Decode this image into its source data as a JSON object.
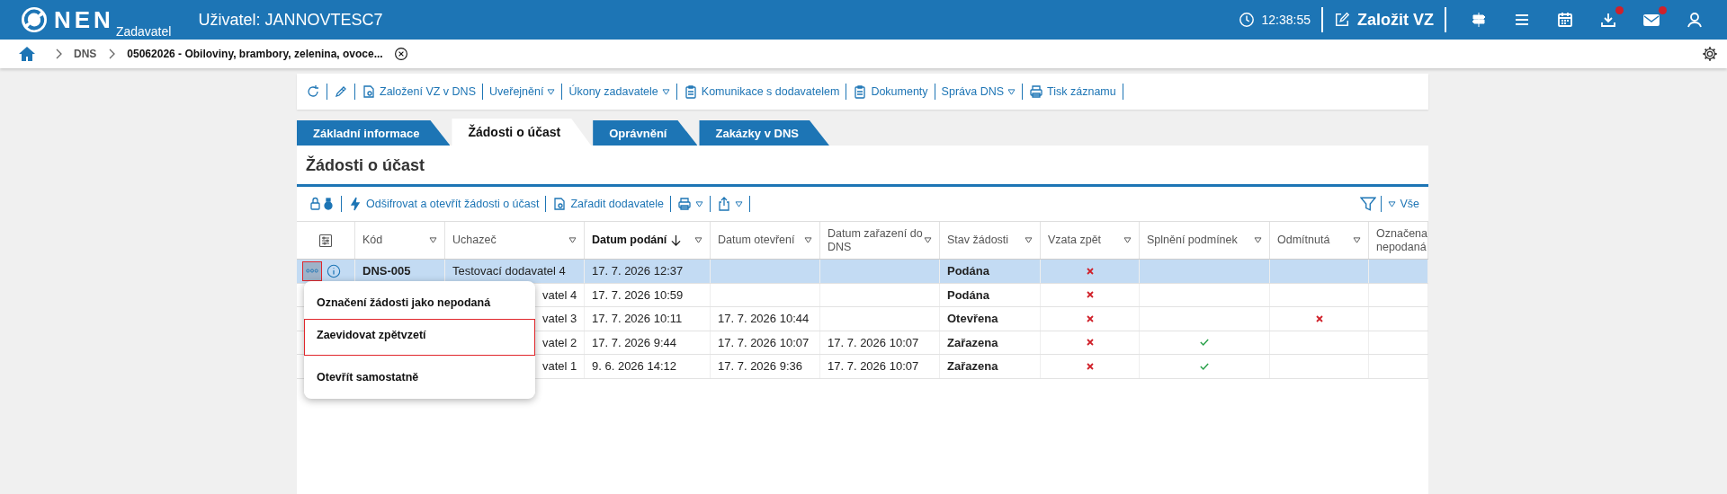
{
  "header": {
    "logo": "NEN",
    "role": "Zadavatel",
    "user": "Uživatel: JANNOVTESC7",
    "time": "12:38:55",
    "create_button": "Založit VZ",
    "icons": [
      {
        "kind": "signpost",
        "badge": false
      },
      {
        "kind": "menu",
        "badge": false
      },
      {
        "kind": "calendar",
        "badge": false
      },
      {
        "kind": "download",
        "badge": true
      },
      {
        "kind": "mail",
        "badge": true
      },
      {
        "kind": "user",
        "badge": false
      }
    ]
  },
  "breadcrumb": [
    "DNS",
    "05062026 - Obiloviny, brambory, zelenina, ovoce..."
  ],
  "toolbar": [
    {
      "kind": "refresh",
      "dropdown": false
    },
    {
      "kind": "pencil",
      "dropdown": false
    },
    {
      "kind": "gear-doc",
      "label": "Založení VZ v DNS",
      "dropdown": false
    },
    {
      "kind": "text",
      "label": "Uveřejnění",
      "dropdown": true
    },
    {
      "kind": "text",
      "label": "Úkony zadavatele",
      "dropdown": true
    },
    {
      "kind": "clipboard",
      "label": "Komunikace s dodavatelem",
      "dropdown": false
    },
    {
      "kind": "clipboard",
      "label": "Dokumenty",
      "dropdown": false
    },
    {
      "kind": "text",
      "label": "Správa DNS",
      "dropdown": true
    },
    {
      "kind": "printer",
      "label": "Tisk záznamu",
      "dropdown": false
    }
  ],
  "tabs": [
    {
      "label": "Základní informace",
      "selected": false
    },
    {
      "label": "Žádosti o účast",
      "selected": true
    },
    {
      "label": "Oprávnění",
      "selected": false
    },
    {
      "label": "Zakázky v DNS",
      "selected": false
    }
  ],
  "section": {
    "title": "Žádosti o účast",
    "actions": [
      {
        "kind": "lock",
        "dropdown": false
      },
      {
        "kind": "bolt",
        "label": "Odšifrovat a otevřít žádosti o účast",
        "dropdown": false
      },
      {
        "kind": "gear-doc",
        "label": "Zařadit dodavatele",
        "dropdown": false
      },
      {
        "kind": "printer",
        "dropdown": true
      },
      {
        "kind": "share",
        "dropdown": true
      }
    ],
    "filter_label": "Vše"
  },
  "table": {
    "columns": [
      {
        "label": "Kód",
        "sorted": false
      },
      {
        "label": "Uchazeč",
        "sorted": false
      },
      {
        "label": "Datum podání",
        "sorted": true
      },
      {
        "label": "Datum otevření",
        "sorted": false
      },
      {
        "label": "Datum zařazení do DNS",
        "sorted": false
      },
      {
        "label": "Stav žádosti",
        "sorted": false
      },
      {
        "label": "Vzata zpět",
        "sorted": false
      },
      {
        "label": "Splnění podmínek",
        "sorted": false
      },
      {
        "label": "Odmítnutá",
        "sorted": false
      },
      {
        "label": "Označena nepodaná",
        "sorted": false
      }
    ],
    "rows": [
      {
        "selected": true,
        "menu_open": true,
        "code": "DNS-005",
        "applicant": "Testovací dodavatel 4",
        "submitted": "17. 7. 2026 12:37",
        "status": "Podána",
        "withdrawn": {
          "kind": "cross"
        }
      },
      {
        "selected": false,
        "menu_open": false,
        "applicant": "vatel 4",
        "submitted": "17. 7. 2026 10:59",
        "status": "Podána",
        "withdrawn": {
          "kind": "cross"
        }
      },
      {
        "selected": false,
        "menu_open": false,
        "applicant": "vatel 3",
        "submitted": "17. 7. 2026 10:11",
        "opened": "17. 7. 2026 10:44",
        "status": "Otevřena",
        "withdrawn": {
          "kind": "cross"
        },
        "rejected": {
          "kind": "cross"
        }
      },
      {
        "selected": false,
        "menu_open": false,
        "applicant": "vatel 2",
        "submitted": "17. 7. 2026 9:44",
        "opened": "17. 7. 2026 10:07",
        "included": "17. 7. 2026 10:07",
        "status": "Zařazena",
        "withdrawn": {
          "kind": "cross"
        },
        "conditions": {
          "kind": "check"
        }
      },
      {
        "selected": false,
        "menu_open": false,
        "applicant": "vatel 1",
        "submitted": "9. 6. 2026 14:12",
        "opened": "17. 7. 2026 9:36",
        "included": "17. 7. 2026 10:07",
        "status": "Zařazena",
        "withdrawn": {
          "kind": "cross"
        },
        "conditions": {
          "kind": "check"
        }
      }
    ]
  },
  "context_menu": {
    "items": [
      {
        "label": "Označení žádosti jako nepodaná",
        "selected": false
      },
      {
        "label": "Zaevidovat zpětvzetí",
        "selected": true
      },
      {
        "label": "Otevřít samostatně",
        "selected": false
      }
    ]
  }
}
